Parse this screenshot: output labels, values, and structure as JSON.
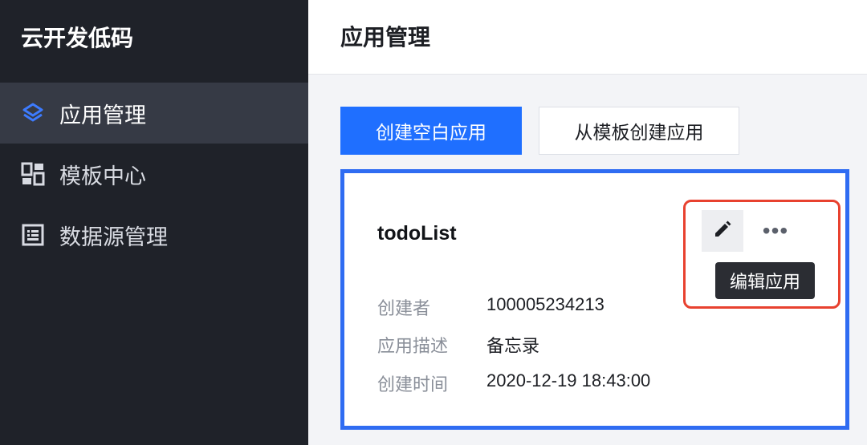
{
  "sidebar": {
    "brand": "云开发低码",
    "items": [
      {
        "label": "应用管理",
        "icon": "layers-icon"
      },
      {
        "label": "模板中心",
        "icon": "template-grid-icon"
      },
      {
        "label": "数据源管理",
        "icon": "datasource-icon"
      }
    ]
  },
  "header": {
    "title": "应用管理"
  },
  "actions": {
    "create_blank": "创建空白应用",
    "create_from_template": "从模板创建应用"
  },
  "app_card": {
    "name": "todoList",
    "creator_label": "创建者",
    "creator_value": "100005234213",
    "desc_label": "应用描述",
    "desc_value": "备忘录",
    "time_label": "创建时间",
    "time_value": "2020-12-19 18:43:00",
    "more_glyph": "•••",
    "tooltip": "编辑应用"
  },
  "colors": {
    "accent": "#1f6fff",
    "sidebar_bg": "#1f2229",
    "highlight_red": "#e8412f",
    "card_border": "#2f6cf2"
  }
}
